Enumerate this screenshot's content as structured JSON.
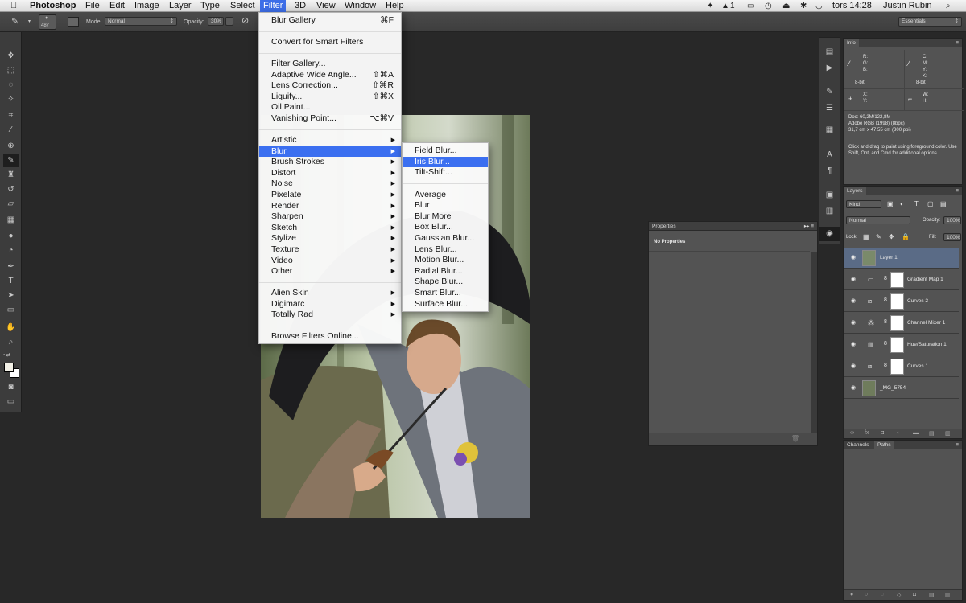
{
  "menubar": {
    "app": "Photoshop",
    "items": [
      "File",
      "Edit",
      "Image",
      "Layer",
      "Type",
      "Select",
      "Filter",
      "3D",
      "View",
      "Window",
      "Help"
    ],
    "active": "Filter",
    "clock": "tors 14:28",
    "user": "Justin Rubin",
    "status_extra": "1"
  },
  "options": {
    "brush_size": "487",
    "mode_label": "Mode:",
    "mode_value": "Normal",
    "opacity_label": "Opacity:",
    "opacity_value": "30%",
    "workspace": "Essentials"
  },
  "filter_menu": {
    "items": [
      {
        "label": "Blur Gallery",
        "shortcut": "⌘F"
      },
      {
        "label": "Convert for Smart Filters"
      },
      {
        "label": "Filter Gallery..."
      },
      {
        "label": "Adaptive Wide Angle...",
        "shortcut": "⇧⌘A"
      },
      {
        "label": "Lens Correction...",
        "shortcut": "⇧⌘R"
      },
      {
        "label": "Liquify...",
        "shortcut": "⇧⌘X"
      },
      {
        "label": "Oil Paint..."
      },
      {
        "label": "Vanishing Point...",
        "shortcut": "⌥⌘V"
      },
      {
        "label": "Artistic"
      },
      {
        "label": "Blur"
      },
      {
        "label": "Brush Strokes"
      },
      {
        "label": "Distort"
      },
      {
        "label": "Noise"
      },
      {
        "label": "Pixelate"
      },
      {
        "label": "Render"
      },
      {
        "label": "Sharpen"
      },
      {
        "label": "Sketch"
      },
      {
        "label": "Stylize"
      },
      {
        "label": "Texture"
      },
      {
        "label": "Video"
      },
      {
        "label": "Other"
      },
      {
        "label": "Alien Skin"
      },
      {
        "label": "Digimarc"
      },
      {
        "label": "Totally Rad"
      },
      {
        "label": "Browse Filters Online..."
      }
    ]
  },
  "blur_submenu": {
    "items": [
      "Field Blur...",
      "Iris Blur...",
      "Tilt-Shift...",
      "Average",
      "Blur",
      "Blur More",
      "Box Blur...",
      "Gaussian Blur...",
      "Lens Blur...",
      "Motion Blur...",
      "Radial Blur...",
      "Shape Blur...",
      "Smart Blur...",
      "Surface Blur..."
    ],
    "highlighted": "Iris Blur..."
  },
  "info_panel": {
    "title": "Info",
    "rgb": [
      "R:",
      "G:",
      "B:"
    ],
    "cmyk": [
      "C:",
      "M:",
      "Y:",
      "K:"
    ],
    "bit1": "8-bit",
    "bit2": "8-bit",
    "xy": [
      "X:",
      "Y:"
    ],
    "wh": [
      "W:",
      "H:"
    ],
    "doc": "Doc: 60,2M/122,8M",
    "profile": "Adobe RGB (1998) (8bpc)",
    "size": "31,7 cm x 47,55 cm (300 ppi)",
    "hint": "Click and drag to paint using foreground color.  Use Shift, Opt, and Cmd for additional options."
  },
  "properties_panel": {
    "title": "Properties",
    "content": "No Properties"
  },
  "layers_panel": {
    "title": "Layers",
    "kind": "Kind",
    "blend": "Normal",
    "opacity_label": "Opacity:",
    "opacity": "100%",
    "lock_label": "Lock:",
    "fill_label": "Fill:",
    "fill": "100%",
    "layers": [
      "Layer 1",
      "Gradient Map 1",
      "Curves 2",
      "Channel Mixer 1",
      "Hue/Saturation 1",
      "Curves 1",
      "_MG_5754"
    ]
  },
  "channels_panel": {
    "tabs": [
      "Channels",
      "Paths"
    ]
  }
}
